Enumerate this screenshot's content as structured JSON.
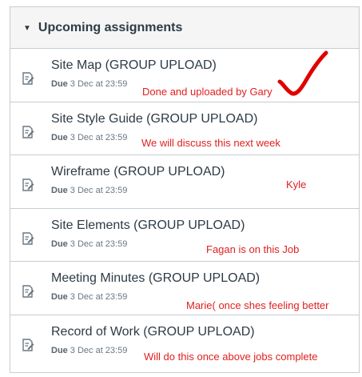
{
  "header": {
    "title": "Upcoming assignments",
    "caret_icon": "caret-down-icon"
  },
  "assignments": [
    {
      "name": "Site Map (GROUP UPLOAD)",
      "due_label": "Due",
      "due_date": "3 Dec at 23:59",
      "note": "Done and uploaded by Gary",
      "icon": "assignment-icon"
    },
    {
      "name": "Site Style Guide (GROUP UPLOAD)",
      "due_label": "Due",
      "due_date": "3 Dec at 23:59",
      "note": "We will discuss this next week",
      "icon": "assignment-icon"
    },
    {
      "name": "Wireframe (GROUP UPLOAD)",
      "due_label": "Due",
      "due_date": "3 Dec at 23:59",
      "note": "Kyle",
      "icon": "assignment-icon"
    },
    {
      "name": "Site Elements (GROUP UPLOAD)",
      "due_label": "Due",
      "due_date": "3 Dec at 23:59",
      "note": "Fagan is on this Job",
      "icon": "assignment-icon"
    },
    {
      "name": "Meeting Minutes (GROUP UPLOAD)",
      "due_label": "Due",
      "due_date": "3 Dec at 23:59",
      "note": "Marie( once shes feeling better",
      "icon": "assignment-icon"
    },
    {
      "name": "Record of Work (GROUP UPLOAD)",
      "due_label": "Due",
      "due_date": "3 Dec at 23:59",
      "note": "Will do this once above jobs complete",
      "icon": "assignment-icon"
    }
  ],
  "annotation_colors": {
    "note_text": "#e02020",
    "checkmark": "#e00000"
  },
  "annotation_icons": {
    "checkmark": "red-checkmark-icon"
  }
}
